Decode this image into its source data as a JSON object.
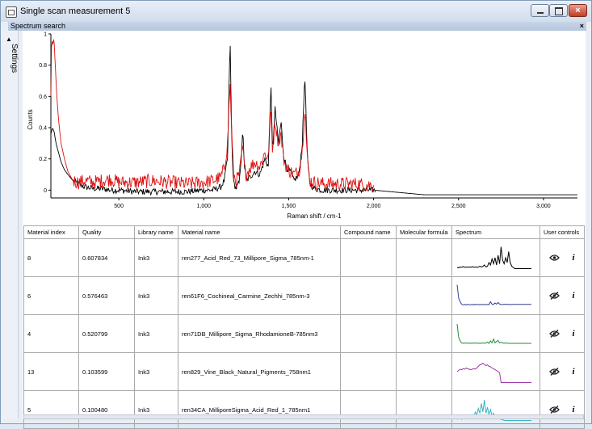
{
  "window": {
    "title": "Single scan measurement 5"
  },
  "panel": {
    "title": "Spectrum search",
    "close_symbol": "×"
  },
  "settings": {
    "label": "Settings",
    "arrow": "▲"
  },
  "window_controls": {
    "close_symbol": "×"
  },
  "chart_data": {
    "type": "line",
    "xlabel": "Raman shift / cm-1",
    "ylabel": "Counts",
    "x_ticks": [
      "500",
      "1,000",
      "1,500",
      "2,000",
      "2,500",
      "3,000"
    ],
    "y_ticks": [
      "0",
      "0.2",
      "0.4",
      "0.6",
      "0.8",
      "1"
    ],
    "xlim": [
      100,
      3200
    ],
    "ylim": [
      -0.05,
      1.0
    ],
    "colors": {
      "red": "#dd1111",
      "black": "#000000"
    },
    "series": [
      {
        "color": "#000000",
        "x": [
          100,
          110,
          120,
          130,
          145,
          160,
          180,
          200,
          230,
          260,
          300,
          350,
          400,
          450,
          500,
          600,
          700,
          800,
          900,
          1000,
          1050,
          1100,
          1120,
          1140,
          1155,
          1165,
          1175,
          1190,
          1210,
          1230,
          1240,
          1250,
          1270,
          1300,
          1330,
          1360,
          1380,
          1395,
          1405,
          1420,
          1440,
          1455,
          1470,
          1490,
          1510,
          1530,
          1560,
          1580,
          1595,
          1610,
          1625,
          1650,
          1700,
          1800,
          1900,
          2000,
          2300,
          3200
        ],
        "y": [
          0.36,
          0.4,
          0.37,
          0.3,
          0.24,
          0.18,
          0.13,
          0.1,
          0.06,
          0.04,
          0.02,
          0.01,
          0.01,
          0.0,
          0.0,
          -0.01,
          -0.01,
          -0.01,
          -0.01,
          0.0,
          0.0,
          0.02,
          0.06,
          0.2,
          0.98,
          0.3,
          0.05,
          0.01,
          0.05,
          0.37,
          0.15,
          0.06,
          0.08,
          0.12,
          0.1,
          0.2,
          0.15,
          0.68,
          0.25,
          0.52,
          0.3,
          0.44,
          0.22,
          0.14,
          0.12,
          0.06,
          0.1,
          0.3,
          0.75,
          0.2,
          0.04,
          0.01,
          0.0,
          0.0,
          0.0,
          0.0,
          -0.03,
          -0.03
        ]
      },
      {
        "color": "#dd1111",
        "x": [
          100,
          105,
          110,
          118,
          125,
          135,
          145,
          160,
          180,
          200,
          230,
          260,
          300,
          350,
          400,
          450,
          500,
          600,
          700,
          800,
          900,
          1000,
          1050,
          1100,
          1120,
          1140,
          1155,
          1165,
          1175,
          1190,
          1210,
          1230,
          1240,
          1250,
          1270,
          1300,
          1330,
          1360,
          1380,
          1395,
          1405,
          1420,
          1440,
          1455,
          1470,
          1490,
          1510,
          1530,
          1560,
          1580,
          1595,
          1610,
          1625,
          1650,
          1700,
          1800,
          1900,
          2000
        ],
        "y": [
          0.6,
          1.0,
          0.92,
          0.98,
          0.82,
          0.6,
          0.45,
          0.3,
          0.2,
          0.12,
          0.06,
          0.05,
          0.06,
          0.05,
          0.06,
          0.07,
          0.05,
          0.05,
          0.06,
          0.05,
          0.04,
          0.05,
          0.06,
          0.08,
          0.14,
          0.3,
          0.7,
          0.35,
          0.1,
          0.06,
          0.1,
          0.28,
          0.14,
          0.1,
          0.14,
          0.18,
          0.15,
          0.24,
          0.2,
          0.52,
          0.25,
          0.44,
          0.3,
          0.36,
          0.2,
          0.14,
          0.12,
          0.1,
          0.12,
          0.25,
          0.55,
          0.18,
          0.06,
          0.05,
          0.04,
          0.04,
          0.04,
          0.03
        ]
      }
    ]
  },
  "table": {
    "columns": [
      "Material index",
      "Quality",
      "Library name",
      "Material name",
      "Compound name",
      "Molecular formula",
      "Spectrum",
      "User controls"
    ],
    "rows": [
      {
        "index": "8",
        "quality": "0.607834",
        "library": "Ink3",
        "material": "ren277_Acid_Red_73_Millipore_Sigma_785nm-1",
        "compound": "",
        "formula": "",
        "visible": true,
        "color": "#000000",
        "thumb": [
          0.1,
          0.08,
          0.12,
          0.1,
          0.14,
          0.1,
          0.12,
          0.1,
          0.12,
          0.1,
          0.14,
          0.1,
          0.12,
          0.1,
          0.12,
          0.15,
          0.12,
          0.14,
          0.2,
          0.12,
          0.15,
          0.3,
          0.2,
          0.45,
          0.25,
          0.5,
          0.2,
          0.6,
          0.25,
          0.95,
          0.4,
          0.25,
          0.5,
          0.3,
          0.75,
          0.3,
          0.15,
          0.1,
          0.05,
          0.05,
          0.05,
          0.05,
          0.05,
          0.05,
          0.05,
          0.05,
          0.05,
          0.05,
          0.05,
          0.05
        ]
      },
      {
        "index": "6",
        "quality": "0.576463",
        "library": "Ink3",
        "material": "ren61F6_Cochineal_Carmine_Zechhi_785nm-3",
        "compound": "",
        "formula": "",
        "visible": false,
        "color": "#2f3f94",
        "thumb": [
          0.95,
          0.4,
          0.25,
          0.15,
          0.12,
          0.14,
          0.12,
          0.15,
          0.12,
          0.13,
          0.14,
          0.12,
          0.15,
          0.13,
          0.14,
          0.12,
          0.14,
          0.13,
          0.14,
          0.12,
          0.15,
          0.13,
          0.25,
          0.15,
          0.14,
          0.2,
          0.15,
          0.22,
          0.15,
          0.14,
          0.13,
          0.15,
          0.14,
          0.14,
          0.15,
          0.13,
          0.14,
          0.14,
          0.14,
          0.14,
          0.14,
          0.14,
          0.14,
          0.14,
          0.14,
          0.14,
          0.14,
          0.14,
          0.14,
          0.14
        ]
      },
      {
        "index": "4",
        "quality": "0.520799",
        "library": "Ink3",
        "material": "ren71DB_Millipore_Sigma_RhodamioneB-785nm3",
        "compound": "",
        "formula": "",
        "visible": false,
        "color": "#1e8c3a",
        "thumb": [
          0.9,
          0.35,
          0.2,
          0.12,
          0.1,
          0.12,
          0.1,
          0.12,
          0.1,
          0.11,
          0.1,
          0.12,
          0.1,
          0.12,
          0.1,
          0.11,
          0.1,
          0.12,
          0.1,
          0.12,
          0.15,
          0.1,
          0.2,
          0.12,
          0.28,
          0.12,
          0.18,
          0.22,
          0.12,
          0.15,
          0.12,
          0.1,
          0.12,
          0.11,
          0.1,
          0.1,
          0.1,
          0.1,
          0.1,
          0.1,
          0.1,
          0.1,
          0.1,
          0.1,
          0.1,
          0.1,
          0.1,
          0.1,
          0.1,
          0.1
        ]
      },
      {
        "index": "13",
        "quality": "0.103599",
        "library": "Ink3",
        "material": "ren829_Vine_Black_Natural_Pigments_758nm1",
        "compound": "",
        "formula": "",
        "visible": false,
        "color": "#9b3aa8",
        "thumb": [
          0.5,
          0.55,
          0.6,
          0.58,
          0.62,
          0.6,
          0.65,
          0.62,
          0.6,
          0.58,
          0.6,
          0.62,
          0.6,
          0.65,
          0.72,
          0.78,
          0.8,
          0.85,
          0.8,
          0.75,
          0.78,
          0.72,
          0.7,
          0.65,
          0.62,
          0.58,
          0.55,
          0.5,
          0.45,
          0.05,
          0.05,
          0.05,
          0.05,
          0.05,
          0.05,
          0.05,
          0.05,
          0.05,
          0.05,
          0.05,
          0.05,
          0.05,
          0.05,
          0.05,
          0.05,
          0.05,
          0.05,
          0.05,
          0.05,
          0.05
        ]
      },
      {
        "index": "5",
        "quality": "0.100480",
        "library": "Ink3",
        "material": "ren34CA_MilliporeSigma_Acid_Red_1_785nm1",
        "compound": "",
        "formula": "",
        "visible": false,
        "color": "#3ab3be",
        "thumb": [
          0.1,
          0.12,
          0.15,
          0.1,
          0.18,
          0.12,
          0.2,
          0.15,
          0.25,
          0.18,
          0.3,
          0.22,
          0.4,
          0.3,
          0.55,
          0.35,
          0.75,
          0.4,
          0.9,
          0.35,
          0.6,
          0.3,
          0.5,
          0.25,
          0.35,
          0.2,
          0.25,
          0.15,
          0.12,
          0.1,
          0.08,
          0.06,
          0.05,
          0.05,
          0.05,
          0.05,
          0.05,
          0.05,
          0.05,
          0.05,
          0.05,
          0.05,
          0.05,
          0.05,
          0.05,
          0.05,
          0.05,
          0.05,
          0.05,
          0.05
        ]
      }
    ]
  }
}
